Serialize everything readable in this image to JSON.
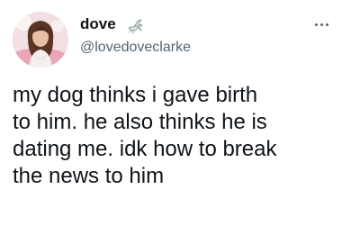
{
  "tweet": {
    "author": {
      "display_name": "dove",
      "handle": "@lovedoveclarke",
      "name_emoji": "dove-icon",
      "avatar": "avatar-photo"
    },
    "more_icon": "more-horizontal-icon",
    "text_lines": [
      "my dog thinks i gave birth",
      "to him. he also thinks he is",
      "dating me. idk how to break",
      "the news to him"
    ]
  },
  "colors": {
    "text_primary": "#0f1419",
    "text_secondary": "#536471",
    "background": "#ffffff"
  }
}
